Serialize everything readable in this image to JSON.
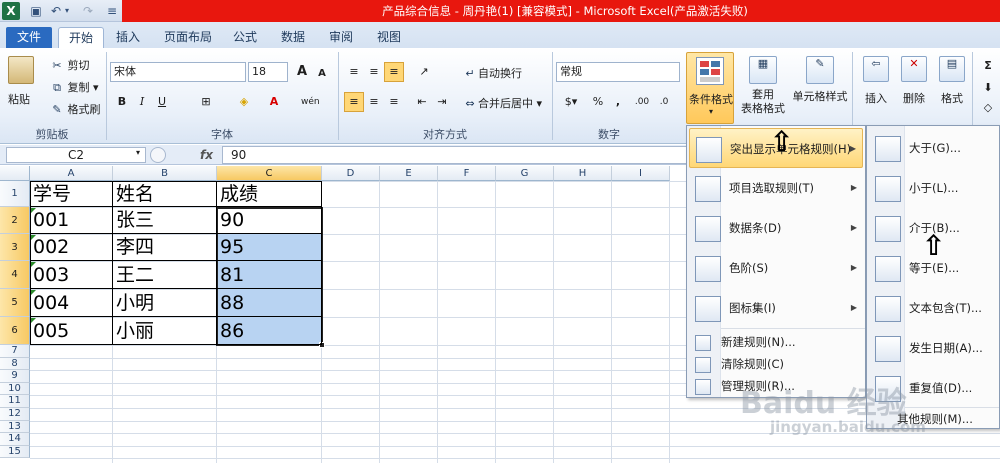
{
  "window": {
    "title": "产品综合信息 - 周丹艳(1)  [兼容模式]  -  Microsoft Excel(产品激活失败)"
  },
  "quick_access": {
    "logo": "X"
  },
  "tabs": [
    "文件",
    "开始",
    "插入",
    "页面布局",
    "公式",
    "数据",
    "审阅",
    "视图"
  ],
  "ribbon": {
    "clipboard": {
      "paste": "粘贴",
      "cut": "剪切",
      "copy": "复制",
      "format_painter": "格式刷",
      "label": "剪贴板"
    },
    "font": {
      "name": "宋体",
      "size": "18",
      "label": "字体",
      "bold": "B",
      "italic": "I",
      "underline": "U",
      "grow": "A",
      "shrink": "A",
      "phonetic": "wén"
    },
    "alignment": {
      "wrap": "自动换行",
      "merge": "合并后居中",
      "label": "对齐方式"
    },
    "number": {
      "format": "常规",
      "percent": "%",
      "comma": ",",
      "label": "数字",
      "inc_decimal": ".00",
      "dec_decimal": ".0"
    },
    "styles": {
      "conditional": "条件格式",
      "table": "套用\n表格格式",
      "cell_styles": "单元格样式"
    },
    "cells": {
      "insert": "插入",
      "delete": "删除",
      "format": "格式"
    }
  },
  "formula_bar": {
    "name_box": "C2",
    "fx": "fx",
    "value": "90"
  },
  "sheet": {
    "columns": [
      "A",
      "B",
      "C",
      "D",
      "E",
      "F",
      "G",
      "H",
      "I"
    ],
    "rows": [
      "1",
      "2",
      "3",
      "4",
      "5",
      "6",
      "7",
      "8",
      "9",
      "10",
      "11",
      "12",
      "13",
      "14",
      "15"
    ],
    "table": [
      [
        "学号",
        "姓名",
        "成绩"
      ],
      [
        "001",
        "张三",
        "90"
      ],
      [
        "002",
        "李四",
        "95"
      ],
      [
        "003",
        "王二",
        "81"
      ],
      [
        "004",
        "小明",
        "88"
      ],
      [
        "005",
        "小丽",
        "86"
      ]
    ]
  },
  "menu_conditional": {
    "items": [
      {
        "label": "突出显示单元格规则(H)",
        "icon": "highlight-rules-icon"
      },
      {
        "label": "项目选取规则(T)",
        "icon": "top-bottom-rules-icon"
      },
      {
        "label": "数据条(D)",
        "icon": "data-bars-icon"
      },
      {
        "label": "色阶(S)",
        "icon": "color-scales-icon"
      },
      {
        "label": "图标集(I)",
        "icon": "icon-sets-icon"
      }
    ],
    "small_items": [
      {
        "label": "新建规则(N)...",
        "icon": "new-rule-icon"
      },
      {
        "label": "清除规则(C)",
        "icon": "clear-rules-icon"
      },
      {
        "label": "管理规则(R)...",
        "icon": "manage-rules-icon"
      }
    ]
  },
  "menu_highlight": {
    "items": [
      {
        "label": "大于(G)...",
        "icon": "greater-than-icon"
      },
      {
        "label": "小于(L)...",
        "icon": "less-than-icon"
      },
      {
        "label": "介于(B)...",
        "icon": "between-icon"
      },
      {
        "label": "等于(E)...",
        "icon": "equal-to-icon"
      },
      {
        "label": "文本包含(T)...",
        "icon": "text-contains-icon"
      },
      {
        "label": "发生日期(A)...",
        "icon": "date-occurring-icon"
      },
      {
        "label": "重复值(D)...",
        "icon": "duplicate-values-icon"
      }
    ],
    "more": "其他规则(M)..."
  },
  "watermark": {
    "line1": "Baidu 经验",
    "line2": "jingyan.baidu.com"
  }
}
